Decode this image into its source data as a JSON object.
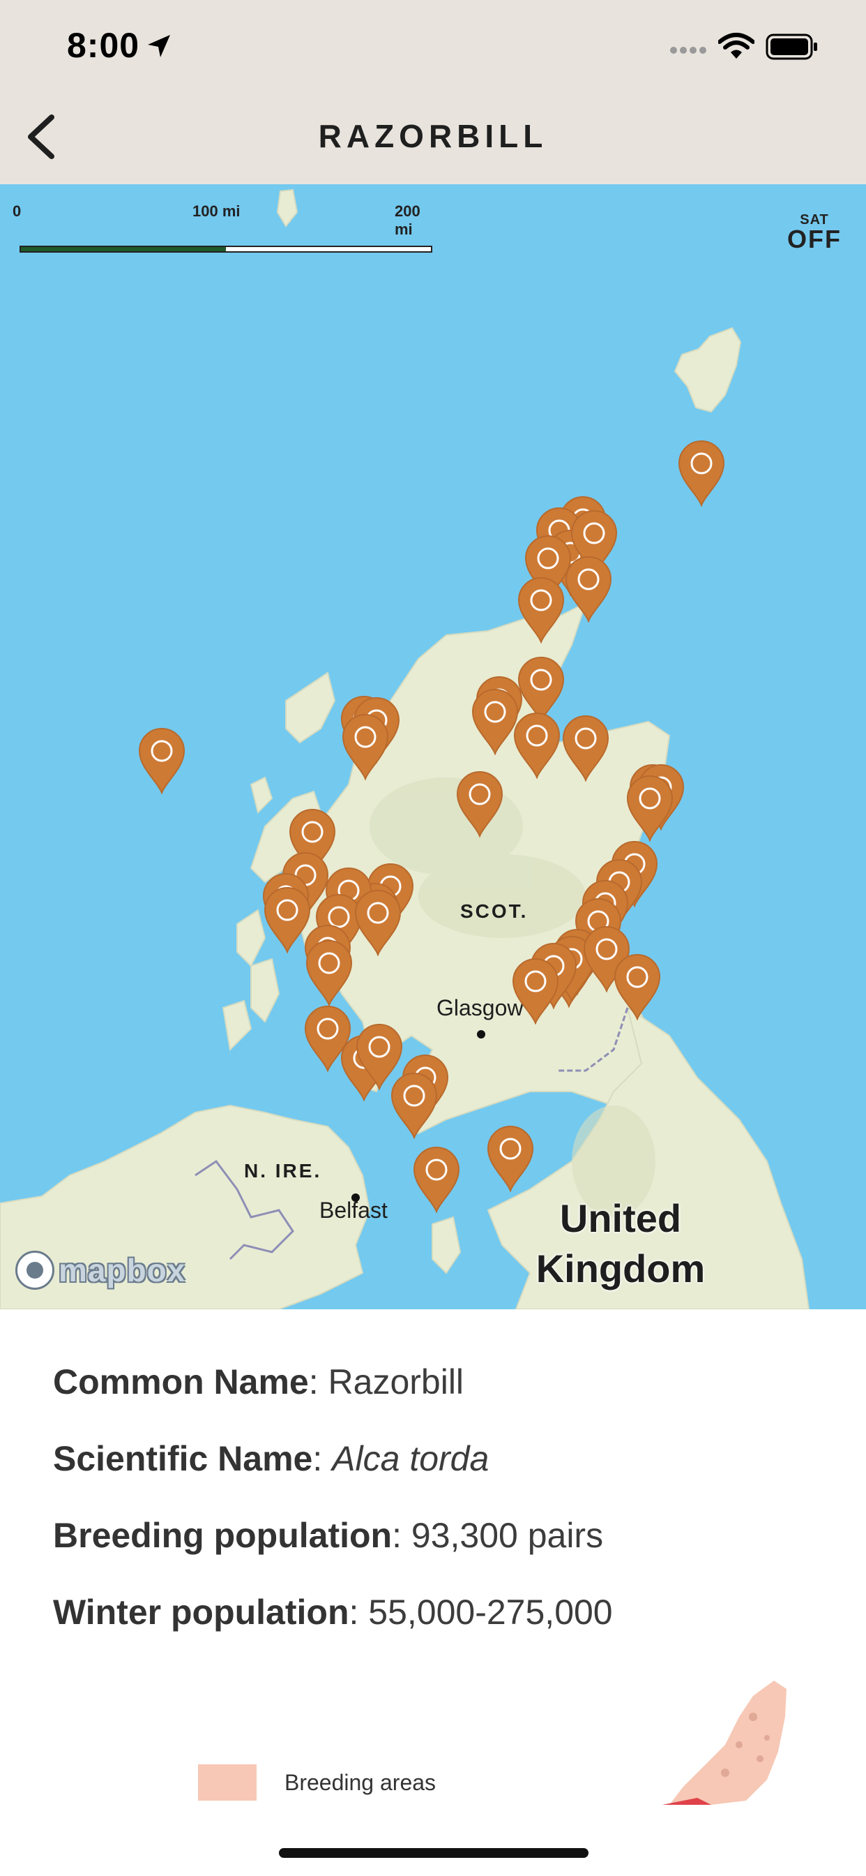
{
  "status_bar": {
    "time": "8:00"
  },
  "header": {
    "title": "RAZORBILL"
  },
  "map": {
    "scale": {
      "labels": [
        "0",
        "100 mi",
        "200 mi"
      ]
    },
    "satellite_toggle": {
      "top": "SAT",
      "state": "OFF"
    },
    "labels": {
      "scotland": "SCOT.",
      "n_ireland": "N. IRE.",
      "glasgow": "Glasgow",
      "belfast": "Belfast",
      "uk": "United Kingdom"
    },
    "attribution": "mapbox",
    "pin_color": "#cd7a35",
    "water_color": "#74c9ef",
    "land_color": "#e8ecd3"
  },
  "info": {
    "common_name_label": "Common Name",
    "common_name": "Razorbill",
    "scientific_name_label": "Scientific Name",
    "scientific_name": "Alca torda",
    "breeding_label": "Breeding population",
    "breeding_value": "93,300 pairs",
    "winter_label": "Winter population",
    "winter_value": "55,000-275,000"
  },
  "legend": {
    "breeding_label": "Breeding areas",
    "breeding_color": "#f7c8b5"
  }
}
